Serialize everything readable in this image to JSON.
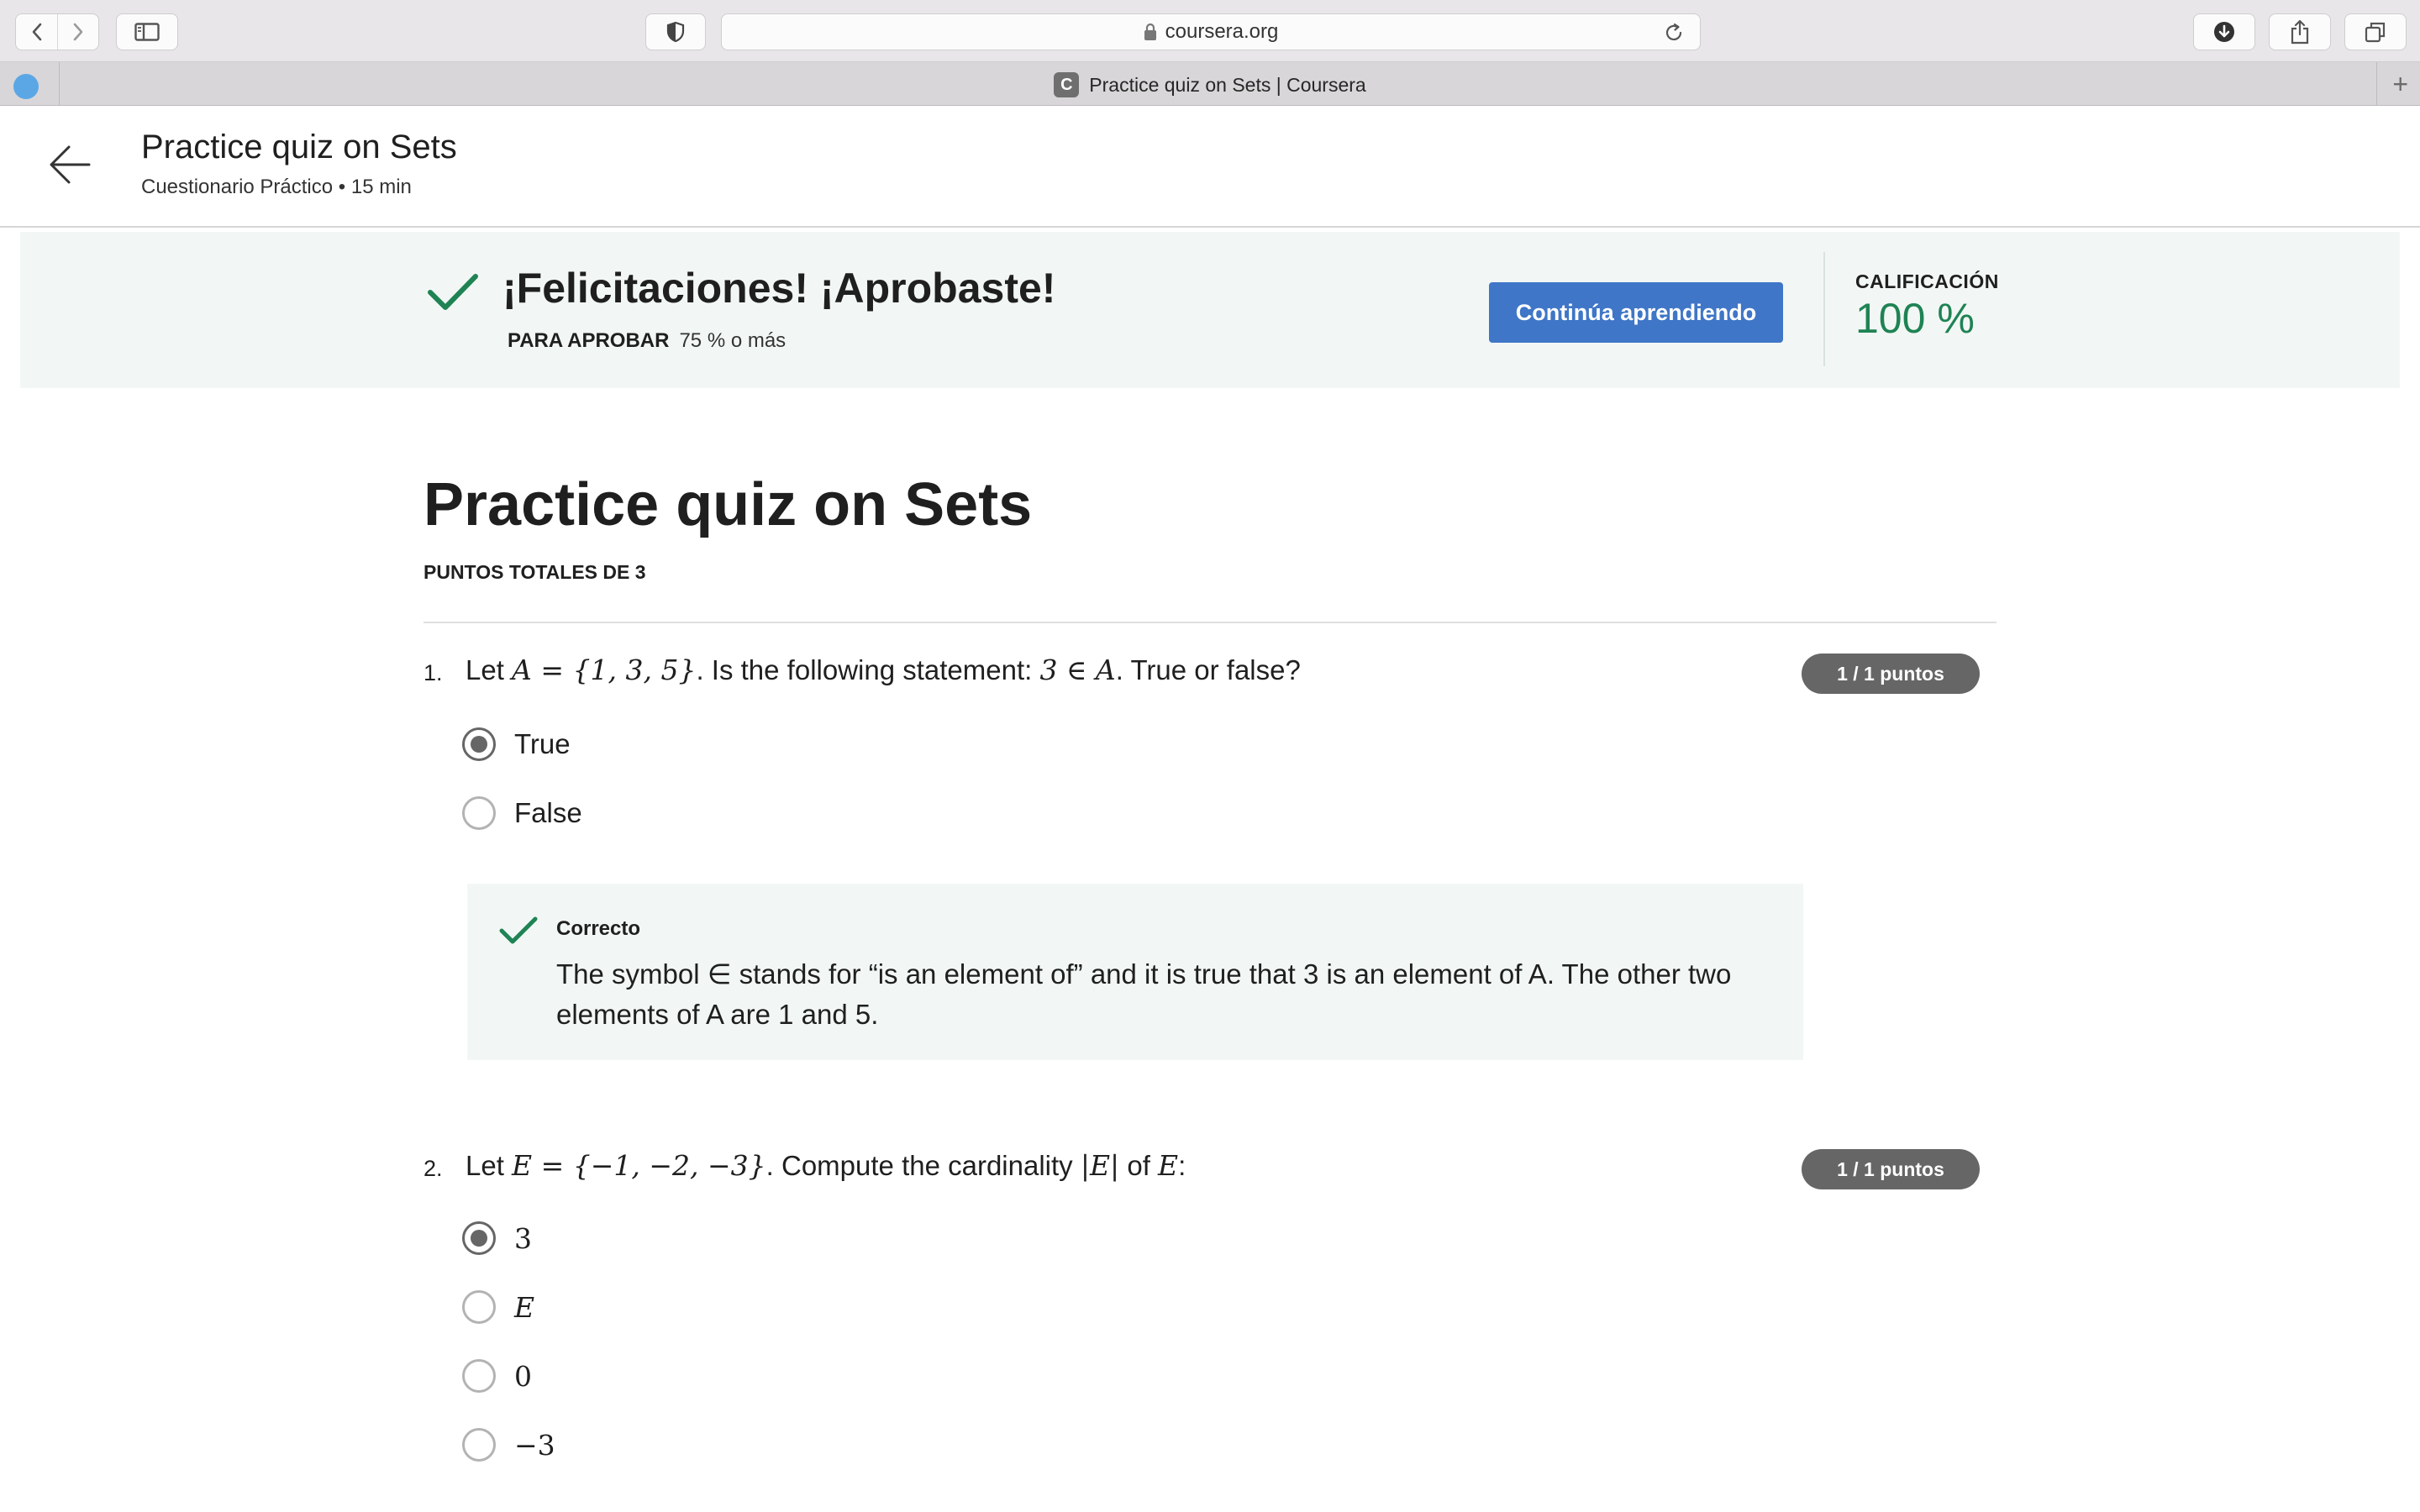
{
  "browser": {
    "url": "coursera.org",
    "tab_title": "Practice quiz on Sets | Coursera",
    "tab_favicon_letter": "C"
  },
  "header": {
    "title": "Practice quiz on Sets",
    "subtitle": "Cuestionario Práctico • 15 min"
  },
  "banner": {
    "title": "¡Felicitaciones! ¡Aprobaste!",
    "pass_label": "PARA APROBAR",
    "pass_value": "75 % o más",
    "continue_label": "Continúa aprendiendo",
    "grade_label": "CALIFICACIÓN",
    "grade_value": "100 %",
    "grade_color": "#1f8354",
    "button_color": "#3f76c7"
  },
  "quiz": {
    "title": "Practice quiz on Sets",
    "total_points": "PUNTOS TOTALES DE 3",
    "questions": [
      {
        "number": "1.",
        "text_before": "Let ",
        "math1": "A = {1, 3, 5}",
        "text_mid": ". Is the following statement: ",
        "math2": "3 ∈ A",
        "text_after": ". True or false?",
        "score": "1 / 1 puntos",
        "options": [
          {
            "label": "True",
            "selected": true
          },
          {
            "label": "False",
            "selected": false
          }
        ],
        "feedback": {
          "title": "Correcto",
          "text": "The symbol ∈ stands for “is an element of” and it is true that 3 is an element of A. The other two elements of A are 1 and 5."
        }
      },
      {
        "number": "2.",
        "text_before": "Let ",
        "math1": "E = {−1, −2, −3}",
        "text_mid": ". Compute the cardinality ",
        "math2": "|E|",
        "text_after_pre": " of ",
        "math3": "E",
        "text_after": ":",
        "score": "1 / 1 puntos",
        "options": [
          {
            "label": "3",
            "selected": true
          },
          {
            "label": "E",
            "selected": false
          },
          {
            "label": "0",
            "selected": false
          },
          {
            "label": "−3",
            "selected": false
          }
        ]
      }
    ]
  },
  "icons": {
    "back": "arrow-left-icon",
    "check": "checkmark-icon",
    "lock": "lock-icon",
    "reload": "reload-icon",
    "download": "download-icon",
    "share": "share-icon",
    "tabs": "tabs-overview-icon",
    "sidebar": "sidebar-icon",
    "shield": "privacy-shield-icon"
  }
}
